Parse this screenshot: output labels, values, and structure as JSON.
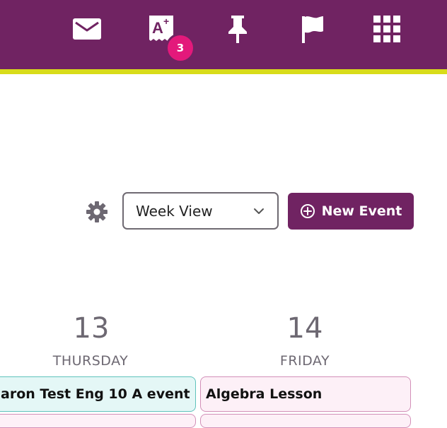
{
  "header": {
    "icons": [
      "mail-icon",
      "grades-icon",
      "pin-icon",
      "flag-icon",
      "apps-grid-icon"
    ],
    "grades_badge": "3",
    "colors": {
      "bar": "#702362",
      "accent_line": "#d8dc1a",
      "badge": "#e3197b"
    }
  },
  "toolbar": {
    "view_select_value": "Week View",
    "new_event_label": "New Event"
  },
  "calendar": {
    "days": [
      {
        "number": "13",
        "name": "THURSDAY"
      },
      {
        "number": "14",
        "name": "FRIDAY"
      }
    ],
    "events": [
      {
        "day": "THURSDAY",
        "title": "aron Test Eng 10 A event"
      },
      {
        "day": "FRIDAY",
        "title": "Algebra Lesson"
      }
    ]
  }
}
